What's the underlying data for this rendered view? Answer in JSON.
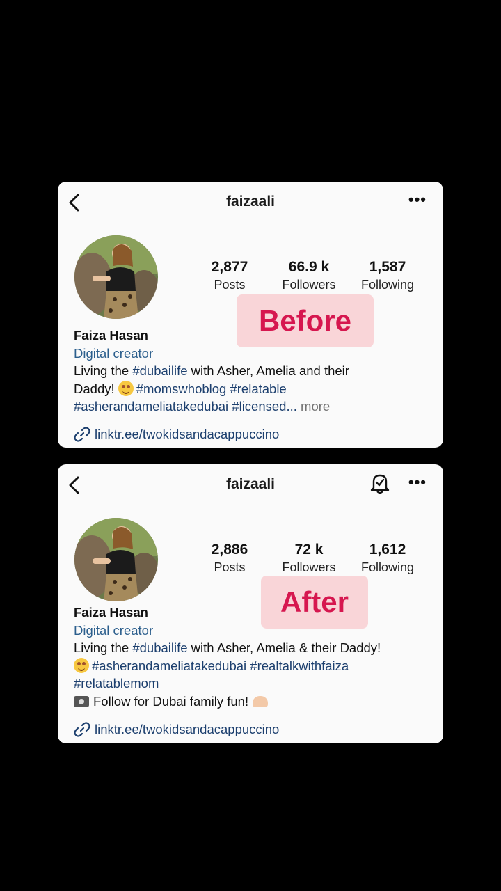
{
  "before": {
    "username": "faizaali",
    "stats": [
      {
        "value": "2,877",
        "label": "Posts"
      },
      {
        "value": "66.9 k",
        "label": "Followers"
      },
      {
        "value": "1,587",
        "label": "Following"
      }
    ],
    "tag_label": "Before",
    "name": "Faiza Hasan",
    "category": "Digital creator",
    "bio_line1_a": "Living the ",
    "bio_line1_hash": "#dubailife",
    "bio_line1_b": " with Asher, Amelia and their",
    "bio_line2_a": "Daddy! ",
    "bio_line2_hash": "#momswhoblog #relatable",
    "bio_line3_hash": "#asherandameliatakedubai #licensed...",
    "bio_more": " more",
    "link_text": "linktr.ee/twokidsandacappuccino"
  },
  "after": {
    "username": "faizaali",
    "stats": [
      {
        "value": "2,886",
        "label": "Posts"
      },
      {
        "value": "72 k",
        "label": "Followers"
      },
      {
        "value": "1,612",
        "label": "Following"
      }
    ],
    "tag_label": "After",
    "name": "Faiza Hasan",
    "category": "Digital creator",
    "bio_line1_a": "Living the ",
    "bio_line1_hash": "#dubailife",
    "bio_line1_b": " with Asher, Amelia & their Daddy!",
    "bio_line2_hash": "#asherandameliatakedubai #realtalkwithfaiza",
    "bio_line3_hash": "#relatablemom",
    "bio_line4": "Follow for Dubai family fun!",
    "link_text": "linktr.ee/twokidsandacappuccino"
  },
  "icons": {
    "back": "chevron-left-icon",
    "more": "more-options-icon",
    "bell": "notification-bell-icon",
    "link": "link-icon"
  },
  "colors": {
    "tag_bg": "#f9d5d8",
    "tag_text": "#d6174f",
    "hashtag": "#1c3f6e",
    "category": "#2c5f8d"
  }
}
